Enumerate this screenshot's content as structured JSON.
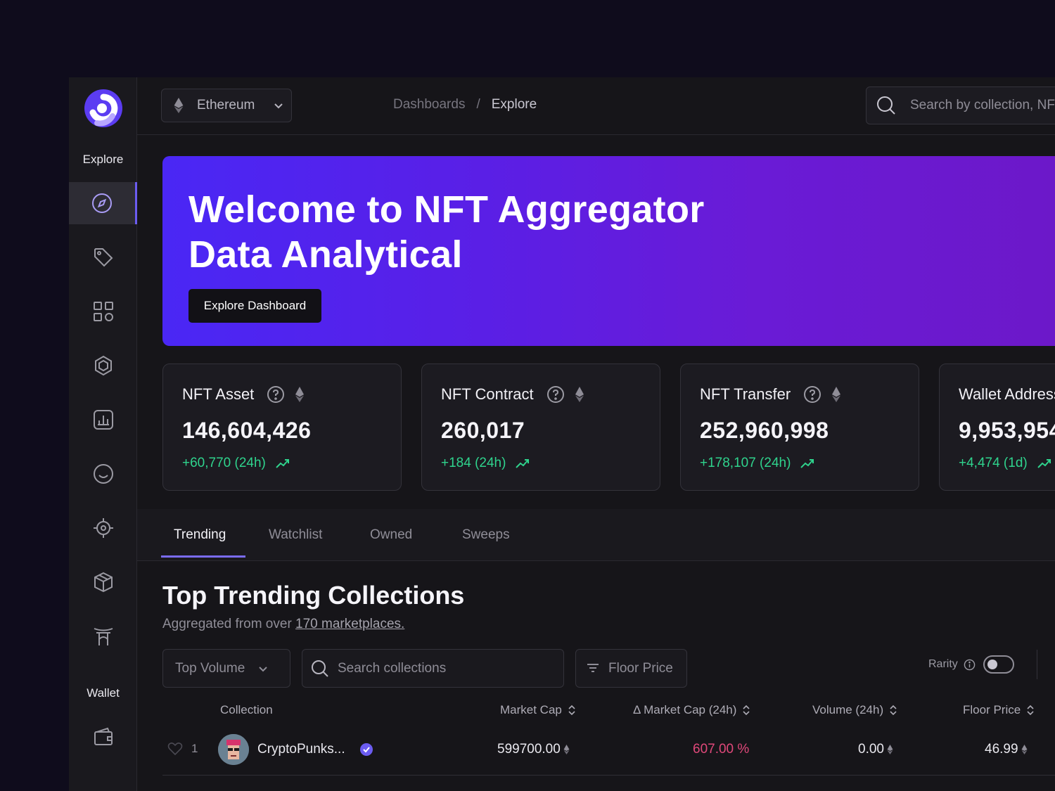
{
  "sidebar": {
    "explore_label": "Explore",
    "wallet_label": "Wallet",
    "items": [
      {
        "name": "compass-icon",
        "active": true
      },
      {
        "name": "tag-icon"
      },
      {
        "name": "grid-icon"
      },
      {
        "name": "hexagon-icon"
      },
      {
        "name": "chart-icon"
      },
      {
        "name": "smile-icon"
      },
      {
        "name": "target-icon"
      },
      {
        "name": "box-icon"
      },
      {
        "name": "arch-icon"
      }
    ]
  },
  "topbar": {
    "network": "Ethereum",
    "breadcrumb": [
      "Dashboards",
      "/",
      "Explore"
    ],
    "search_placeholder": "Search by collection, NFT, and user"
  },
  "hero": {
    "title_line1": "Welcome to NFT Aggregator",
    "title_line2": "Data Analytical",
    "button": "Explore Dashboard"
  },
  "stats": [
    {
      "title": "NFT Asset",
      "value": "146,604,426",
      "change": "+60,770 (24h)"
    },
    {
      "title": "NFT Contract",
      "value": "260,017",
      "change": "+184 (24h)"
    },
    {
      "title": "NFT Transfer",
      "value": "252,960,998",
      "change": "+178,107 (24h)"
    },
    {
      "title": "Wallet Addresses",
      "value": "9,953,954",
      "change": "+4,474 (1d)"
    }
  ],
  "tabs": [
    "Trending",
    "Watchlist",
    "Owned",
    "Sweeps"
  ],
  "section": {
    "title": "Top Trending Collections",
    "subtitle": "Aggregated from over ",
    "subtitle_link": "170 marketplaces."
  },
  "controls": {
    "sort": "Top Volume",
    "search_placeholder": "Search collections",
    "filter": "Floor Price",
    "rarity": "Rarity"
  },
  "table": {
    "columns": [
      "Collection",
      "Market Cap",
      "Δ Market Cap (24h)",
      "Volume (24h)",
      "Floor Price"
    ],
    "rows": [
      {
        "rank": "1",
        "name": "CryptoPunks...",
        "market_cap": "599700.00",
        "delta": "607.00 %",
        "volume": "0.00",
        "floor": "46.99"
      }
    ]
  },
  "colors": {
    "accent": "#6b5cf0",
    "positive": "#2fd38d",
    "negative": "#e0487a",
    "hero_start": "#4a27f5",
    "hero_end": "#6c18c8"
  }
}
